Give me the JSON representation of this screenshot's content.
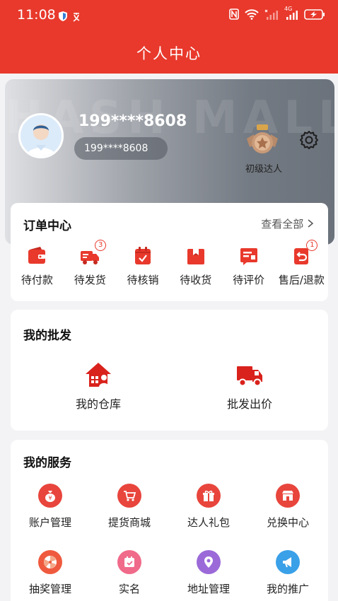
{
  "status_bar": {
    "time": "11:08",
    "network": "4G"
  },
  "header": {
    "title": "个人中心"
  },
  "profile": {
    "watermark": "HASH MALL",
    "username": "199****8608",
    "phone": "199****8608",
    "level": "初级达人"
  },
  "orders": {
    "title": "订单中心",
    "view_all": "查看全部",
    "items": [
      {
        "label": "待付款",
        "icon": "wallet-icon",
        "badge": ""
      },
      {
        "label": "待发货",
        "icon": "delivery-truck-icon",
        "badge": "3"
      },
      {
        "label": "待核销",
        "icon": "calendar-check-icon",
        "badge": ""
      },
      {
        "label": "待收货",
        "icon": "package-icon",
        "badge": ""
      },
      {
        "label": "待评价",
        "icon": "review-icon",
        "badge": ""
      },
      {
        "label": "售后/退款",
        "icon": "refund-icon",
        "badge": "1"
      }
    ]
  },
  "wholesale": {
    "title": "我的批发",
    "items": [
      {
        "label": "我的仓库",
        "icon": "warehouse-icon"
      },
      {
        "label": "批发出价",
        "icon": "truck-icon"
      }
    ]
  },
  "services": {
    "title": "我的服务",
    "items": [
      {
        "label": "账户管理",
        "icon": "money-bag-icon",
        "color": "#e8453c"
      },
      {
        "label": "提货商城",
        "icon": "cart-icon",
        "color": "#e8453c"
      },
      {
        "label": "达人礼包",
        "icon": "gift-icon",
        "color": "#e8453c"
      },
      {
        "label": "兑换中心",
        "icon": "store-icon",
        "color": "#e8453c"
      },
      {
        "label": "抽奖管理",
        "icon": "lottery-wheel-icon",
        "color": "#ef5a3e"
      },
      {
        "label": "实名",
        "icon": "id-check-icon",
        "color": "#f06a8a"
      },
      {
        "label": "地址管理",
        "icon": "map-pin-icon",
        "color": "#9b6ad8"
      },
      {
        "label": "我的推广",
        "icon": "megaphone-icon",
        "color": "#3aa0e8"
      }
    ]
  },
  "colors": {
    "brand_red": "#e8392c"
  }
}
